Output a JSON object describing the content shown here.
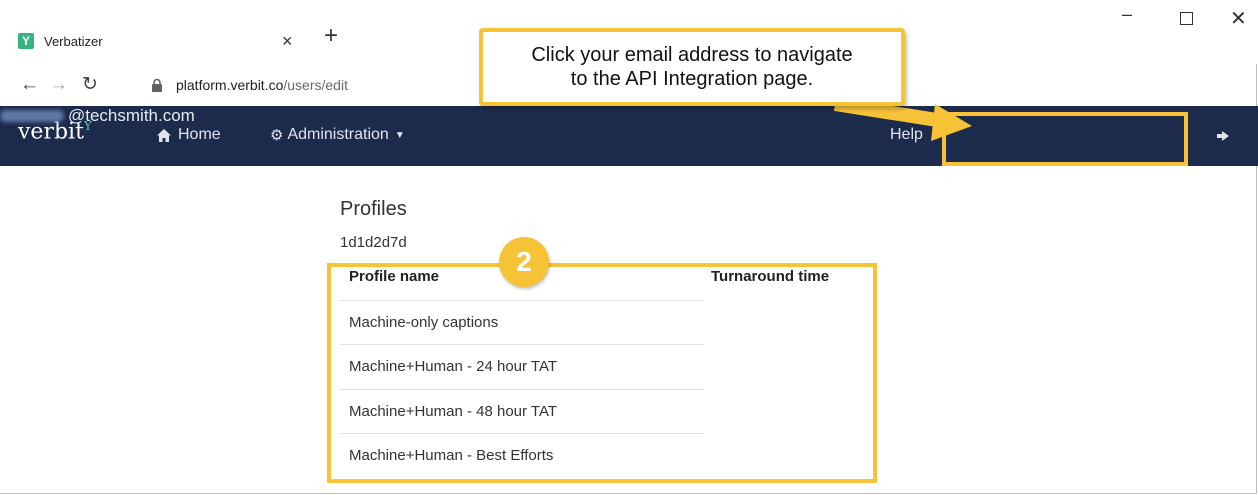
{
  "browser": {
    "tab_title": "Verbatizer",
    "favicon_letter": "Y",
    "url_domain": "platform.verbit.co",
    "url_path": "/users/edit",
    "new_tab_symbol": "+",
    "close_symbol": "×",
    "minimize_symbol": "–",
    "window_close_symbol": "✕"
  },
  "navbar": {
    "brand": "verbit",
    "brand_mark": "Y",
    "home_label": "Home",
    "admin_label": "Administration",
    "help_label": "Help",
    "email_label": "@techsmith.com",
    "colors": {
      "bar": "#1c2a4c",
      "brand_accent": "#4ed1a0"
    }
  },
  "annotation": {
    "callout_text": "Click your email address to navigate\nto the API Integration page.",
    "step_number": "2",
    "highlight_color": "#f6c236"
  },
  "page": {
    "title": "Profiles",
    "account_id": "1d1d2d7d",
    "table": {
      "headers": [
        "Profile name",
        "Turnaround time"
      ],
      "rows": [
        "Machine-only captions",
        "Machine+Human - 24 hour TAT",
        "Machine+Human - 48 hour TAT",
        "Machine+Human - Best Efforts"
      ]
    }
  },
  "icons": {
    "back": "arrow-left-icon",
    "forward": "arrow-right-icon",
    "reload": "reload-icon",
    "lock": "lock-icon",
    "home": "home-icon",
    "admin": "gear-icon",
    "logout": "logout-icon"
  }
}
